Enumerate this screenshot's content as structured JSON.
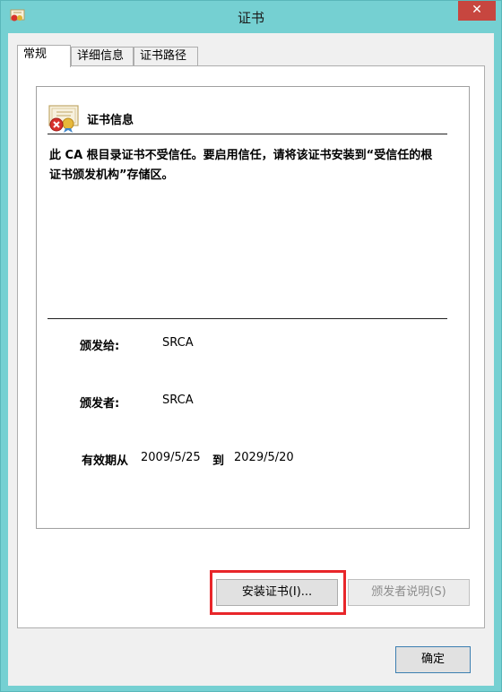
{
  "window": {
    "title": "证书",
    "close_glyph": "✕"
  },
  "tabs": [
    {
      "label": "常规",
      "active": true
    },
    {
      "label": "详细信息",
      "active": false
    },
    {
      "label": "证书路径",
      "active": false
    }
  ],
  "cert_info": {
    "heading": "证书信息",
    "icon": "certificate-error-icon",
    "warning": "此 CA 根目录证书不受信任。要启用信任，请将该证书安装到“受信任的根证书颁发机构”存储区。"
  },
  "fields": {
    "issued_to_label": "颁发给:",
    "issued_to_value": "SRCA",
    "issued_by_label": "颁发者:",
    "issued_by_value": "SRCA",
    "valid_label": "有效期从",
    "valid_from": "2009/5/25",
    "valid_to_label": "到",
    "valid_to": "2029/5/20"
  },
  "buttons": {
    "install": "安装证书(I)...",
    "issuer_statement": "颁发者说明(S)",
    "ok": "确定"
  },
  "colors": {
    "frame": "#75d0d2",
    "close": "#c7463f",
    "highlight": "#e8262a"
  }
}
